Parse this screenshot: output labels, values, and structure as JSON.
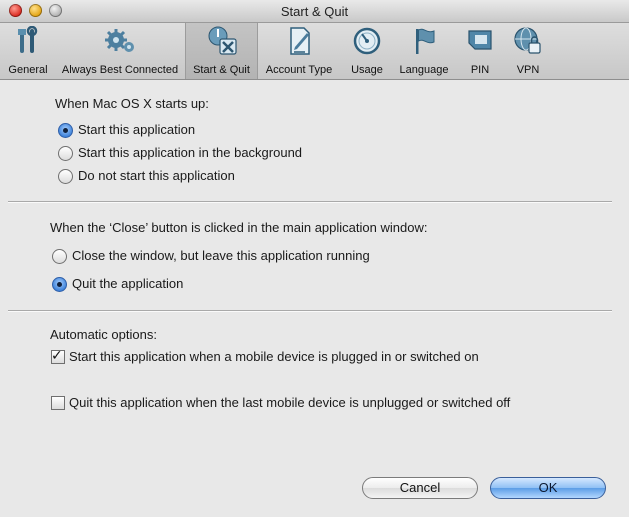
{
  "window": {
    "title": "Start & Quit"
  },
  "toolbar": {
    "items": [
      {
        "label": "General",
        "icon": "wrench-screwdriver-icon"
      },
      {
        "label": "Always Best Connected",
        "icon": "gears-icon"
      },
      {
        "label": "Start & Quit",
        "icon": "start-quit-icon",
        "selected": true
      },
      {
        "label": "Account Type",
        "icon": "account-document-icon"
      },
      {
        "label": "Usage",
        "icon": "gauge-icon"
      },
      {
        "label": "Language",
        "icon": "flag-icon"
      },
      {
        "label": "PIN",
        "icon": "sim-card-icon"
      },
      {
        "label": "VPN",
        "icon": "vpn-globe-lock-icon"
      }
    ]
  },
  "startup": {
    "heading": "When Mac OS X starts up:",
    "options": [
      {
        "label": "Start this application",
        "selected": true
      },
      {
        "label": "Start this application in the background",
        "selected": false
      },
      {
        "label": "Do not start this application",
        "selected": false
      }
    ]
  },
  "close": {
    "heading": "When the ‘Close’ button is clicked in the main application window:",
    "options": [
      {
        "label": "Close the window, but leave this application running",
        "selected": false
      },
      {
        "label": "Quit the application",
        "selected": true
      }
    ]
  },
  "automatic": {
    "heading": "Automatic options:",
    "options": [
      {
        "label": "Start this application when a mobile device is plugged in or switched on",
        "checked": true
      },
      {
        "label": "Quit this application when the last mobile device is unplugged or switched off",
        "checked": false
      }
    ]
  },
  "buttons": {
    "cancel": "Cancel",
    "ok": "OK"
  }
}
